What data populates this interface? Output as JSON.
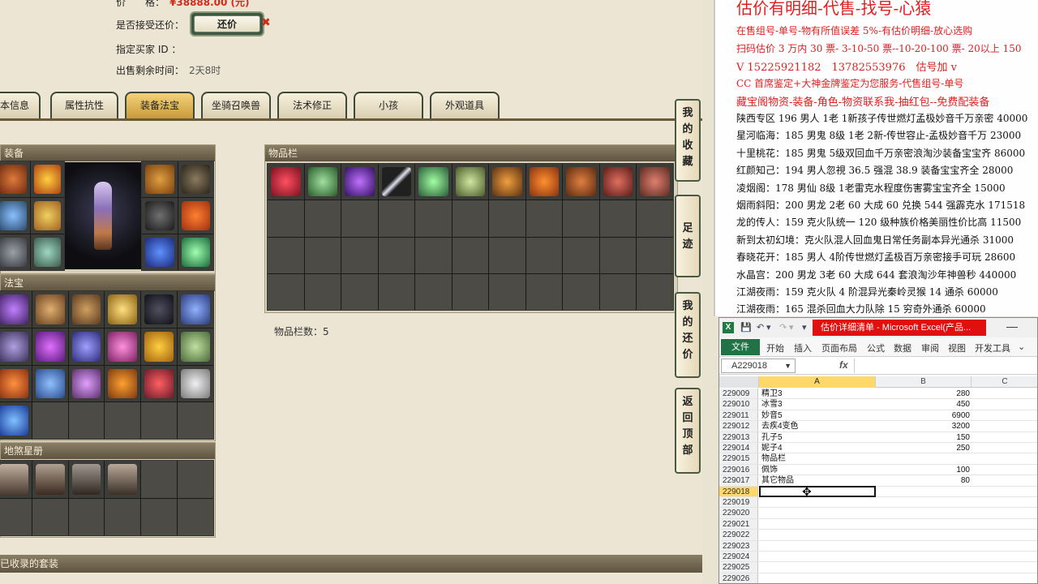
{
  "trade": {
    "price_label": "价　　格：",
    "price_value": "¥38888.00 (元)",
    "accept_label": "是否接受还价：",
    "counter_button": "还价",
    "counter_mark": "✖",
    "buyer_label": "指定买家 ID ：",
    "time_label": "出售剩余时间：",
    "time_value": "2天8时"
  },
  "tabs": [
    "本信息",
    "属性抗性",
    "装备法宝",
    "坐骑召唤兽",
    "法术修正",
    "小孩",
    "外观道具"
  ],
  "active_tab": "装备法宝",
  "panels": {
    "equipment": "装备",
    "fabao": "法宝",
    "inventory": "物品栏",
    "stars": "地煞星册",
    "suits": "已收录的套装"
  },
  "inventory_count_label": "物品栏数：5",
  "side_buttons": [
    {
      "label": "我的收藏",
      "chars": [
        "我",
        "的",
        "收",
        "藏"
      ]
    },
    {
      "label": "足迹",
      "chars": [
        "足",
        "迹"
      ]
    },
    {
      "label": "我的还价",
      "chars": [
        "我",
        "的",
        "还",
        "价"
      ]
    },
    {
      "label": "返回顶部",
      "chars": [
        "返",
        "回",
        "顶",
        "部"
      ]
    }
  ],
  "notes": {
    "headline": "估价有明细-代售-找号-心猿",
    "lines": [
      {
        "text": "在售组号-单号-物有所值误差 5%-有估价明细-放心选购",
        "color": "red"
      },
      {
        "text": "扫码估价 3 万内 30 票- 3-10-50 票--10-20-100 票- 20以上 150",
        "color": "red"
      },
      {
        "text": "V 15225921182　13782553976　估号加 v",
        "color": "red"
      },
      {
        "text": "CC 首席鉴定+大神金牌鉴定为您服务-代售组号-单号",
        "color": "red"
      },
      {
        "text": "藏宝阁物资-装备-角色-物资联系我-抽红包--免费配装备",
        "color": "red"
      },
      {
        "text": "陕西专区 196 男人 1老 1新孩子传世燃灯孟极妙音千万亲密 40000",
        "color": "black"
      },
      {
        "text": "星河临海：185 男鬼 8级 1老 2新-传世容止-孟极妙音千万 23000",
        "color": "black"
      },
      {
        "text": "十里桃花：185 男鬼 5级双回血千万亲密浪淘沙装备宝宝齐 86000",
        "color": "black"
      },
      {
        "text": "红颜知己：194 男人忽視 36.5 强混 38.9 装备宝宝齐全 28000",
        "color": "black"
      },
      {
        "text": "凌烟阁：178 男仙 8级 1老雷克水程度伤害雾宝宝齐全 15000",
        "color": "black"
      },
      {
        "text": "烟雨斜阳：200 男龙 2老 60 大成 60 兑换 544 强霹克水 171518",
        "color": "black"
      },
      {
        "text": "龙的传人：159 克火队统一 120 级种族价格美丽性价比高 11500",
        "color": "black"
      },
      {
        "text": "新到太初幻境：克火队混人回血鬼日常任务副本异光通杀 31000",
        "color": "black"
      },
      {
        "text": "春晓花开：185 男人 4阶传世燃灯孟极百万亲密接手可玩 28600",
        "color": "black"
      },
      {
        "text": "水晶宫：200 男龙 3老 60 大成 644 套浪淘沙年神兽秒 440000",
        "color": "black"
      },
      {
        "text": "江湖夜雨：159 克火队 4 阶混异光秦岭灵猴 14 通杀 60000",
        "color": "black"
      },
      {
        "text": "江湖夜雨：165 混杀回血大力队除 15 穷奇外通杀 60000",
        "color": "black"
      }
    ]
  },
  "excel": {
    "caption": "估价详细清单 - Microsoft Excel(产品...",
    "file_tab": "文件",
    "ribbon_tabs": [
      "开始",
      "插入",
      "页面布局",
      "公式",
      "数据",
      "审阅",
      "视图",
      "开发工具"
    ],
    "name_box": "A229018",
    "fx": "fx",
    "columns": [
      "A",
      "B",
      "C"
    ],
    "rows": [
      {
        "num": "229009",
        "a": "精卫3",
        "b": "280"
      },
      {
        "num": "229010",
        "a": "冰雪3",
        "b": "450"
      },
      {
        "num": "229011",
        "a": "妙音5",
        "b": "6900"
      },
      {
        "num": "229012",
        "a": "去疾4变色",
        "b": "3200"
      },
      {
        "num": "229013",
        "a": "孔子5",
        "b": "150"
      },
      {
        "num": "229014",
        "a": "妮子4",
        "b": "250"
      },
      {
        "num": "229015",
        "a": "物品栏",
        "b": ""
      },
      {
        "num": "229016",
        "a": "佩饰",
        "b": "100"
      },
      {
        "num": "229017",
        "a": "其它物品",
        "b": "80"
      },
      {
        "num": "229018",
        "a": "",
        "b": ""
      },
      {
        "num": "229019",
        "a": "",
        "b": ""
      },
      {
        "num": "229020",
        "a": "",
        "b": ""
      },
      {
        "num": "229021",
        "a": "",
        "b": ""
      },
      {
        "num": "229022",
        "a": "",
        "b": ""
      },
      {
        "num": "229023",
        "a": "",
        "b": ""
      },
      {
        "num": "229024",
        "a": "",
        "b": ""
      },
      {
        "num": "229025",
        "a": "",
        "b": ""
      },
      {
        "num": "229026",
        "a": "",
        "b": ""
      }
    ],
    "selected_row": "229018"
  },
  "colors": {
    "price_red": "#d42a1a",
    "notes_red": "#e02020",
    "excel_green": "#217346",
    "title_red": "#e01010"
  }
}
